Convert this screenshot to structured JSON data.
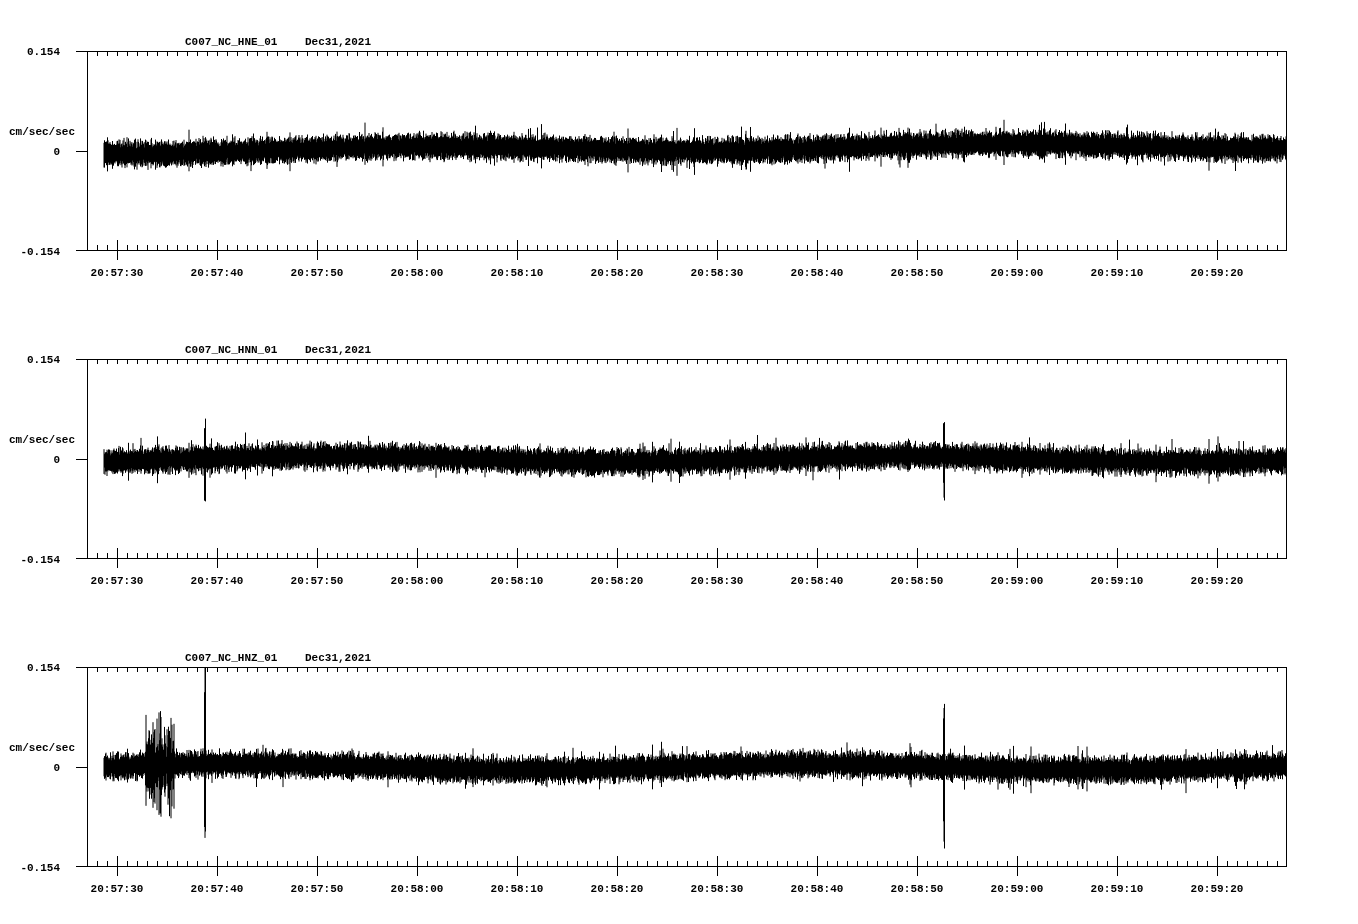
{
  "panels": [
    {
      "station": "C007_NC_HNE_01",
      "date": "Dec31,2021",
      "y_max": "0.154",
      "y_zero": "0",
      "y_min": "-0.154",
      "units": "cm/sec/sec",
      "time_labels": [
        "20:57:30",
        "20:57:40",
        "20:57:50",
        "20:58:00",
        "20:58:10",
        "20:58:20",
        "20:58:30",
        "20:58:40",
        "20:58:50",
        "20:59:00",
        "20:59:10",
        "20:59:20"
      ]
    },
    {
      "station": "C007_NC_HNN_01",
      "date": "Dec31,2021",
      "y_max": "0.154",
      "y_zero": "0",
      "y_min": "-0.154",
      "units": "cm/sec/sec",
      "time_labels": [
        "20:57:30",
        "20:57:40",
        "20:57:50",
        "20:58:00",
        "20:58:10",
        "20:58:20",
        "20:58:30",
        "20:58:40",
        "20:58:50",
        "20:59:00",
        "20:59:10",
        "20:59:20"
      ]
    },
    {
      "station": "C007_NC_HNZ_01",
      "date": "Dec31,2021",
      "y_max": "0.154",
      "y_zero": "0",
      "y_min": "-0.154",
      "units": "cm/sec/sec",
      "time_labels": [
        "20:57:30",
        "20:57:40",
        "20:57:50",
        "20:58:00",
        "20:58:10",
        "20:58:20",
        "20:58:30",
        "20:58:40",
        "20:58:50",
        "20:59:00",
        "20:59:10",
        "20:59:20"
      ]
    }
  ]
}
